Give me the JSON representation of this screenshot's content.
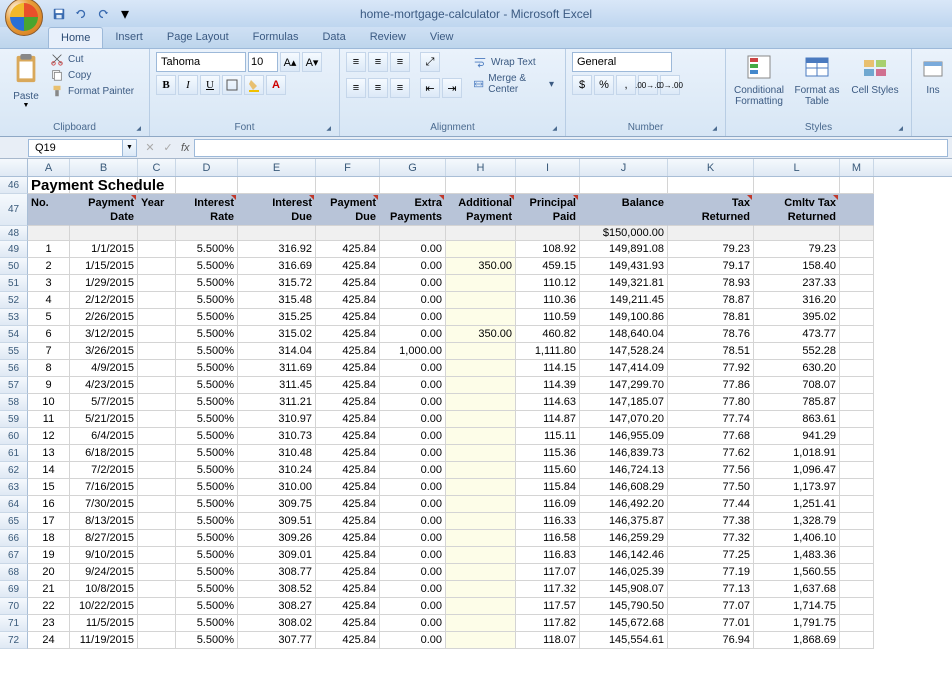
{
  "app_title": "home-mortgage-calculator - Microsoft Excel",
  "tabs": [
    "Home",
    "Insert",
    "Page Layout",
    "Formulas",
    "Data",
    "Review",
    "View"
  ],
  "active_tab": "Home",
  "clipboard": {
    "paste": "Paste",
    "cut": "Cut",
    "copy": "Copy",
    "fmt": "Format Painter",
    "label": "Clipboard"
  },
  "font": {
    "name": "Tahoma",
    "size": "10",
    "label": "Font"
  },
  "alignment": {
    "wrap": "Wrap Text",
    "merge": "Merge & Center",
    "label": "Alignment"
  },
  "number": {
    "format": "General",
    "label": "Number"
  },
  "styles": {
    "cond": "Conditional Formatting",
    "fmt": "Format as Table",
    "cell": "Cell Styles",
    "label": "Styles",
    "ins": "Ins"
  },
  "namebox": "Q19",
  "sheet": {
    "title": "Payment Schedule",
    "initial_balance": "$150,000.00",
    "headers": {
      "no": "No.",
      "pdate": "Payment Date",
      "year": "Year",
      "irate": "Interest Rate",
      "idue": "Interest Due",
      "pdue": "Payment Due",
      "extra": "Extra Payments",
      "addl": "Additional Payment",
      "ppaid": "Principal Paid",
      "bal": "Balance",
      "taxret": "Tax Returned",
      "cumtax": "Cmltv Tax Returned"
    },
    "rows": [
      {
        "n": "1",
        "d": "1/1/2015",
        "r": "5.500%",
        "id": "316.92",
        "pd": "425.84",
        "ep": "0.00",
        "ap": "",
        "pp": "108.92",
        "b": "149,891.08",
        "tr": "79.23",
        "ct": "79.23"
      },
      {
        "n": "2",
        "d": "1/15/2015",
        "r": "5.500%",
        "id": "316.69",
        "pd": "425.84",
        "ep": "0.00",
        "ap": "350.00",
        "pp": "459.15",
        "b": "149,431.93",
        "tr": "79.17",
        "ct": "158.40"
      },
      {
        "n": "3",
        "d": "1/29/2015",
        "r": "5.500%",
        "id": "315.72",
        "pd": "425.84",
        "ep": "0.00",
        "ap": "",
        "pp": "110.12",
        "b": "149,321.81",
        "tr": "78.93",
        "ct": "237.33"
      },
      {
        "n": "4",
        "d": "2/12/2015",
        "r": "5.500%",
        "id": "315.48",
        "pd": "425.84",
        "ep": "0.00",
        "ap": "",
        "pp": "110.36",
        "b": "149,211.45",
        "tr": "78.87",
        "ct": "316.20"
      },
      {
        "n": "5",
        "d": "2/26/2015",
        "r": "5.500%",
        "id": "315.25",
        "pd": "425.84",
        "ep": "0.00",
        "ap": "",
        "pp": "110.59",
        "b": "149,100.86",
        "tr": "78.81",
        "ct": "395.02"
      },
      {
        "n": "6",
        "d": "3/12/2015",
        "r": "5.500%",
        "id": "315.02",
        "pd": "425.84",
        "ep": "0.00",
        "ap": "350.00",
        "pp": "460.82",
        "b": "148,640.04",
        "tr": "78.76",
        "ct": "473.77"
      },
      {
        "n": "7",
        "d": "3/26/2015",
        "r": "5.500%",
        "id": "314.04",
        "pd": "425.84",
        "ep": "1,000.00",
        "ap": "",
        "pp": "1,111.80",
        "b": "147,528.24",
        "tr": "78.51",
        "ct": "552.28"
      },
      {
        "n": "8",
        "d": "4/9/2015",
        "r": "5.500%",
        "id": "311.69",
        "pd": "425.84",
        "ep": "0.00",
        "ap": "",
        "pp": "114.15",
        "b": "147,414.09",
        "tr": "77.92",
        "ct": "630.20"
      },
      {
        "n": "9",
        "d": "4/23/2015",
        "r": "5.500%",
        "id": "311.45",
        "pd": "425.84",
        "ep": "0.00",
        "ap": "",
        "pp": "114.39",
        "b": "147,299.70",
        "tr": "77.86",
        "ct": "708.07"
      },
      {
        "n": "10",
        "d": "5/7/2015",
        "r": "5.500%",
        "id": "311.21",
        "pd": "425.84",
        "ep": "0.00",
        "ap": "",
        "pp": "114.63",
        "b": "147,185.07",
        "tr": "77.80",
        "ct": "785.87"
      },
      {
        "n": "11",
        "d": "5/21/2015",
        "r": "5.500%",
        "id": "310.97",
        "pd": "425.84",
        "ep": "0.00",
        "ap": "",
        "pp": "114.87",
        "b": "147,070.20",
        "tr": "77.74",
        "ct": "863.61"
      },
      {
        "n": "12",
        "d": "6/4/2015",
        "r": "5.500%",
        "id": "310.73",
        "pd": "425.84",
        "ep": "0.00",
        "ap": "",
        "pp": "115.11",
        "b": "146,955.09",
        "tr": "77.68",
        "ct": "941.29"
      },
      {
        "n": "13",
        "d": "6/18/2015",
        "r": "5.500%",
        "id": "310.48",
        "pd": "425.84",
        "ep": "0.00",
        "ap": "",
        "pp": "115.36",
        "b": "146,839.73",
        "tr": "77.62",
        "ct": "1,018.91"
      },
      {
        "n": "14",
        "d": "7/2/2015",
        "r": "5.500%",
        "id": "310.24",
        "pd": "425.84",
        "ep": "0.00",
        "ap": "",
        "pp": "115.60",
        "b": "146,724.13",
        "tr": "77.56",
        "ct": "1,096.47"
      },
      {
        "n": "15",
        "d": "7/16/2015",
        "r": "5.500%",
        "id": "310.00",
        "pd": "425.84",
        "ep": "0.00",
        "ap": "",
        "pp": "115.84",
        "b": "146,608.29",
        "tr": "77.50",
        "ct": "1,173.97"
      },
      {
        "n": "16",
        "d": "7/30/2015",
        "r": "5.500%",
        "id": "309.75",
        "pd": "425.84",
        "ep": "0.00",
        "ap": "",
        "pp": "116.09",
        "b": "146,492.20",
        "tr": "77.44",
        "ct": "1,251.41"
      },
      {
        "n": "17",
        "d": "8/13/2015",
        "r": "5.500%",
        "id": "309.51",
        "pd": "425.84",
        "ep": "0.00",
        "ap": "",
        "pp": "116.33",
        "b": "146,375.87",
        "tr": "77.38",
        "ct": "1,328.79"
      },
      {
        "n": "18",
        "d": "8/27/2015",
        "r": "5.500%",
        "id": "309.26",
        "pd": "425.84",
        "ep": "0.00",
        "ap": "",
        "pp": "116.58",
        "b": "146,259.29",
        "tr": "77.32",
        "ct": "1,406.10"
      },
      {
        "n": "19",
        "d": "9/10/2015",
        "r": "5.500%",
        "id": "309.01",
        "pd": "425.84",
        "ep": "0.00",
        "ap": "",
        "pp": "116.83",
        "b": "146,142.46",
        "tr": "77.25",
        "ct": "1,483.36"
      },
      {
        "n": "20",
        "d": "9/24/2015",
        "r": "5.500%",
        "id": "308.77",
        "pd": "425.84",
        "ep": "0.00",
        "ap": "",
        "pp": "117.07",
        "b": "146,025.39",
        "tr": "77.19",
        "ct": "1,560.55"
      },
      {
        "n": "21",
        "d": "10/8/2015",
        "r": "5.500%",
        "id": "308.52",
        "pd": "425.84",
        "ep": "0.00",
        "ap": "",
        "pp": "117.32",
        "b": "145,908.07",
        "tr": "77.13",
        "ct": "1,637.68"
      },
      {
        "n": "22",
        "d": "10/22/2015",
        "r": "5.500%",
        "id": "308.27",
        "pd": "425.84",
        "ep": "0.00",
        "ap": "",
        "pp": "117.57",
        "b": "145,790.50",
        "tr": "77.07",
        "ct": "1,714.75"
      },
      {
        "n": "23",
        "d": "11/5/2015",
        "r": "5.500%",
        "id": "308.02",
        "pd": "425.84",
        "ep": "0.00",
        "ap": "",
        "pp": "117.82",
        "b": "145,672.68",
        "tr": "77.01",
        "ct": "1,791.75"
      },
      {
        "n": "24",
        "d": "11/19/2015",
        "r": "5.500%",
        "id": "307.77",
        "pd": "425.84",
        "ep": "0.00",
        "ap": "",
        "pp": "118.07",
        "b": "145,554.61",
        "tr": "76.94",
        "ct": "1,868.69"
      }
    ]
  },
  "cols": [
    "A",
    "B",
    "C",
    "D",
    "E",
    "F",
    "G",
    "H",
    "I",
    "J",
    "K",
    "L",
    "M"
  ],
  "row_start": 46
}
